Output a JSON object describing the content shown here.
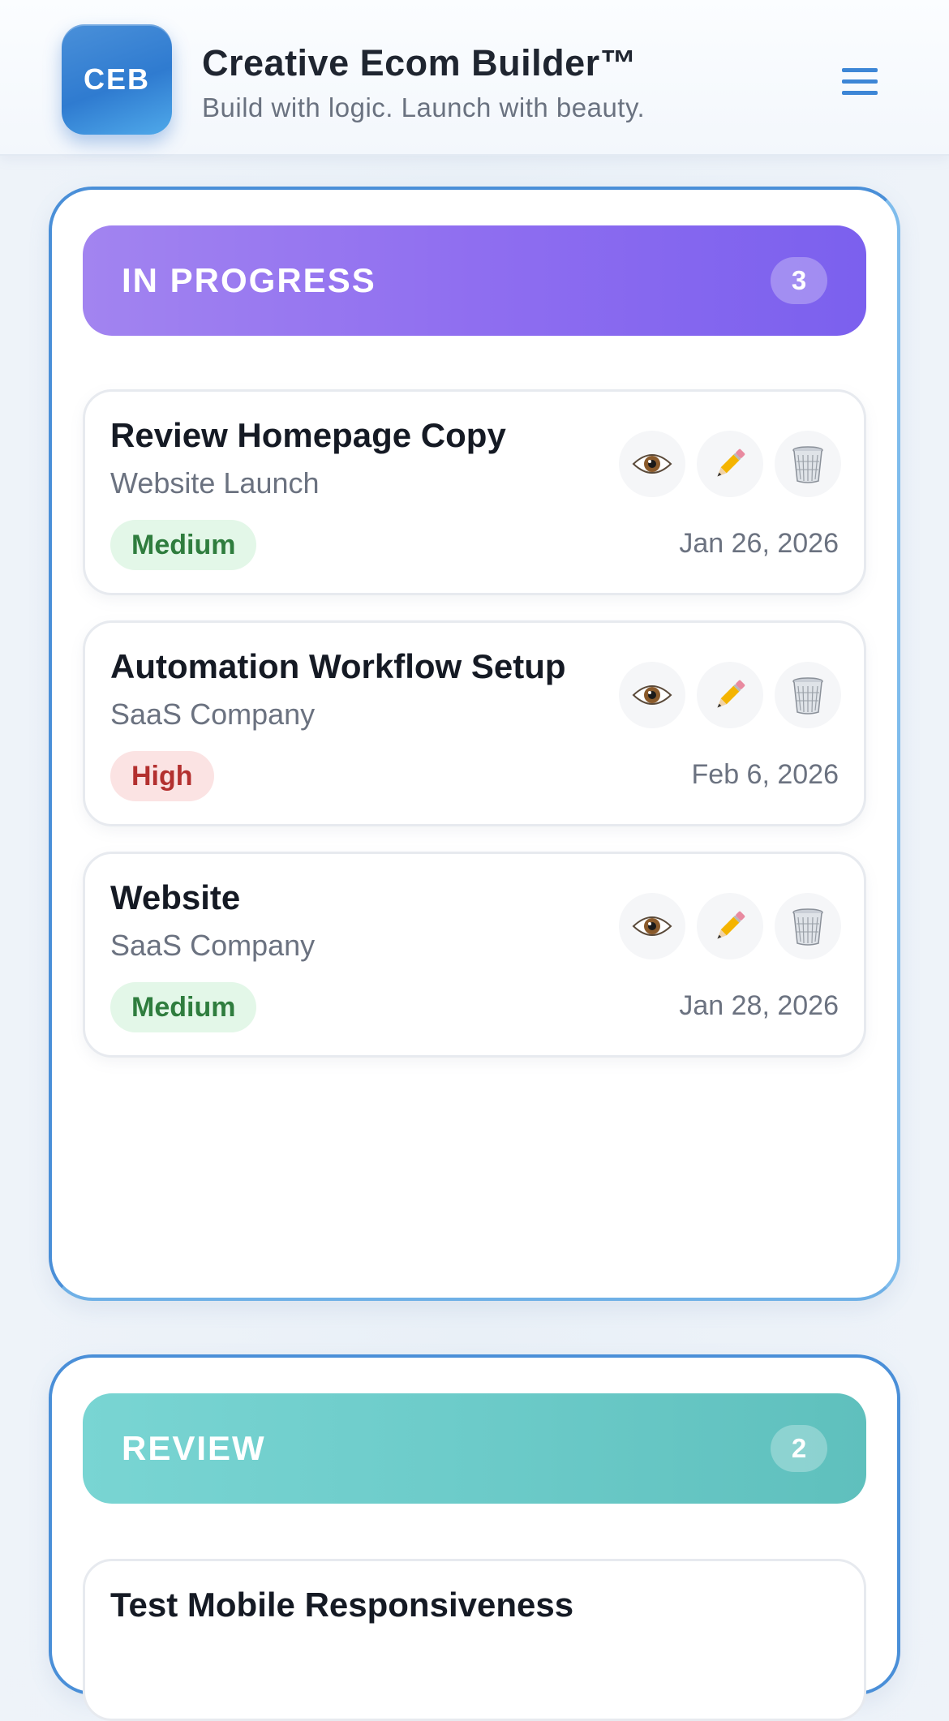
{
  "header": {
    "logo_text": "CEB",
    "title": "Creative Ecom Builder™",
    "subtitle": "Build with logic. Launch with beauty.",
    "menu_icon": "hamburger-menu-icon"
  },
  "columns": [
    {
      "title": "IN PROGRESS",
      "count": "3",
      "accent": "#8f6ef0",
      "cards": [
        {
          "title": "Review Homepage Copy",
          "project": "Website Launch",
          "priority": "Medium",
          "date": "Jan 26, 2026"
        },
        {
          "title": "Automation Workflow Setup",
          "project": "SaaS Company",
          "priority": "High",
          "date": "Feb 6, 2026"
        },
        {
          "title": "Website",
          "project": "SaaS Company",
          "priority": "Medium",
          "date": "Jan 28, 2026"
        }
      ]
    },
    {
      "title": "REVIEW",
      "count": "2",
      "accent": "#6ccbc9",
      "cards": [
        {
          "title": "Test Mobile Responsiveness"
        }
      ]
    }
  ],
  "card_actions": [
    "eye-icon",
    "pencil-icon",
    "trash-icon"
  ],
  "colors": {
    "brand_blue": "#3d86d6",
    "medium_badge_text": "#2f7d3e",
    "high_badge_text": "#b3302f"
  }
}
